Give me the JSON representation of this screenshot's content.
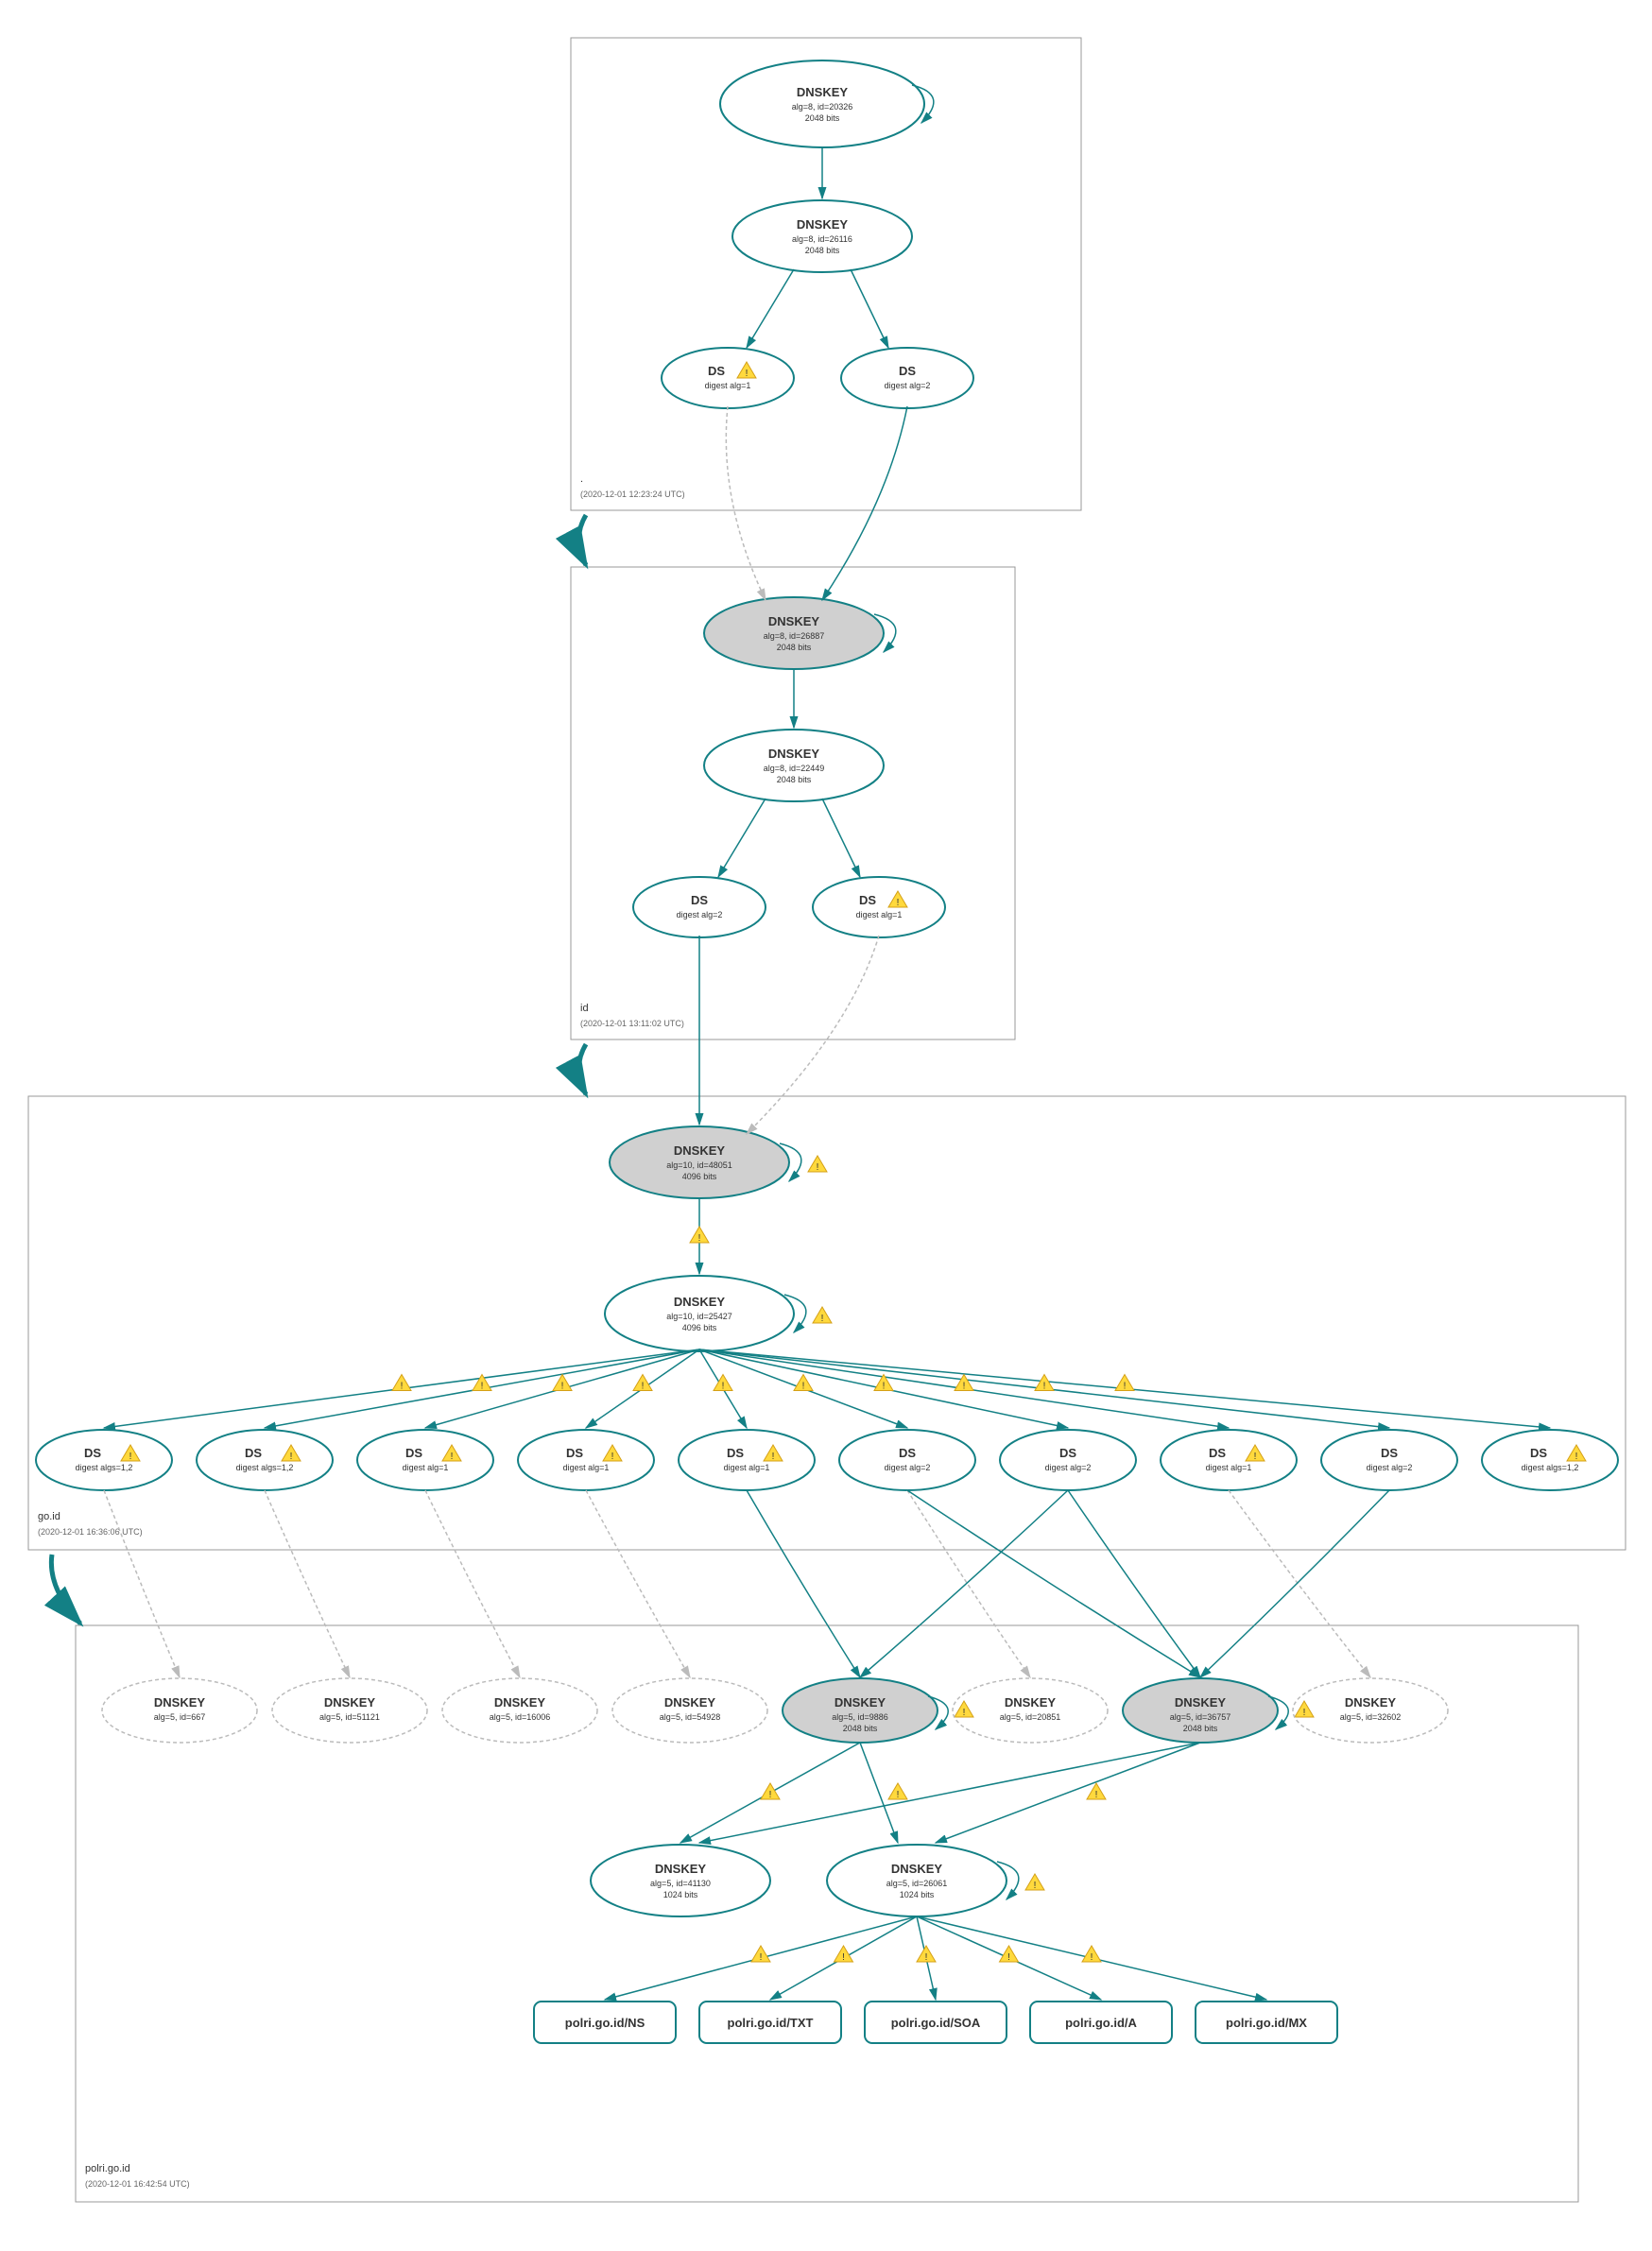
{
  "zones": {
    "root": {
      "label": ".",
      "timestamp": "(2020-12-01 12:23:24 UTC)"
    },
    "id": {
      "label": "id",
      "timestamp": "(2020-12-01 13:11:02 UTC)"
    },
    "goid": {
      "label": "go.id",
      "timestamp": "(2020-12-01 16:36:06 UTC)"
    },
    "polri": {
      "label": "polri.go.id",
      "timestamp": "(2020-12-01 16:42:54 UTC)"
    }
  },
  "nodes": {
    "root_ksk": {
      "title": "DNSKEY",
      "line1": "alg=8, id=20326",
      "line2": "2048 bits"
    },
    "root_zsk": {
      "title": "DNSKEY",
      "line1": "alg=8, id=26116",
      "line2": "2048 bits"
    },
    "root_ds1": {
      "title": "DS",
      "line1": "digest alg=1"
    },
    "root_ds2": {
      "title": "DS",
      "line1": "digest alg=2"
    },
    "id_ksk": {
      "title": "DNSKEY",
      "line1": "alg=8, id=26887",
      "line2": "2048 bits"
    },
    "id_zsk": {
      "title": "DNSKEY",
      "line1": "alg=8, id=22449",
      "line2": "2048 bits"
    },
    "id_ds1": {
      "title": "DS",
      "line1": "digest alg=2"
    },
    "id_ds2": {
      "title": "DS",
      "line1": "digest alg=1"
    },
    "goid_ksk": {
      "title": "DNSKEY",
      "line1": "alg=10, id=48051",
      "line2": "4096 bits"
    },
    "goid_zsk": {
      "title": "DNSKEY",
      "line1": "alg=10, id=25427",
      "line2": "4096 bits"
    },
    "goid_ds0": {
      "title": "DS",
      "line1": "digest algs=1,2"
    },
    "goid_ds1": {
      "title": "DS",
      "line1": "digest algs=1,2"
    },
    "goid_ds2": {
      "title": "DS",
      "line1": "digest alg=1"
    },
    "goid_ds3": {
      "title": "DS",
      "line1": "digest alg=1"
    },
    "goid_ds4": {
      "title": "DS",
      "line1": "digest alg=1"
    },
    "goid_ds5": {
      "title": "DS",
      "line1": "digest alg=2"
    },
    "goid_ds6": {
      "title": "DS",
      "line1": "digest alg=2"
    },
    "goid_ds7": {
      "title": "DS",
      "line1": "digest alg=1"
    },
    "goid_ds8": {
      "title": "DS",
      "line1": "digest alg=2"
    },
    "goid_ds9": {
      "title": "DS",
      "line1": "digest algs=1,2"
    },
    "polri_dk0": {
      "title": "DNSKEY",
      "line1": "alg=5, id=667"
    },
    "polri_dk1": {
      "title": "DNSKEY",
      "line1": "alg=5, id=51121"
    },
    "polri_dk2": {
      "title": "DNSKEY",
      "line1": "alg=5, id=16006"
    },
    "polri_dk3": {
      "title": "DNSKEY",
      "line1": "alg=5, id=54928"
    },
    "polri_dk4": {
      "title": "DNSKEY",
      "line1": "alg=5, id=9886",
      "line2": "2048 bits"
    },
    "polri_dk5": {
      "title": "DNSKEY",
      "line1": "alg=5, id=20851"
    },
    "polri_dk6": {
      "title": "DNSKEY",
      "line1": "alg=5, id=36757",
      "line2": "2048 bits"
    },
    "polri_dk7": {
      "title": "DNSKEY",
      "line1": "alg=5, id=32602"
    },
    "polri_zsk1": {
      "title": "DNSKEY",
      "line1": "alg=5, id=41130",
      "line2": "1024 bits"
    },
    "polri_zsk2": {
      "title": "DNSKEY",
      "line1": "alg=5, id=26061",
      "line2": "1024 bits"
    },
    "rr_ns": {
      "title": "polri.go.id/NS"
    },
    "rr_txt": {
      "title": "polri.go.id/TXT"
    },
    "rr_soa": {
      "title": "polri.go.id/SOA"
    },
    "rr_a": {
      "title": "polri.go.id/A"
    },
    "rr_mx": {
      "title": "polri.go.id/MX"
    }
  }
}
